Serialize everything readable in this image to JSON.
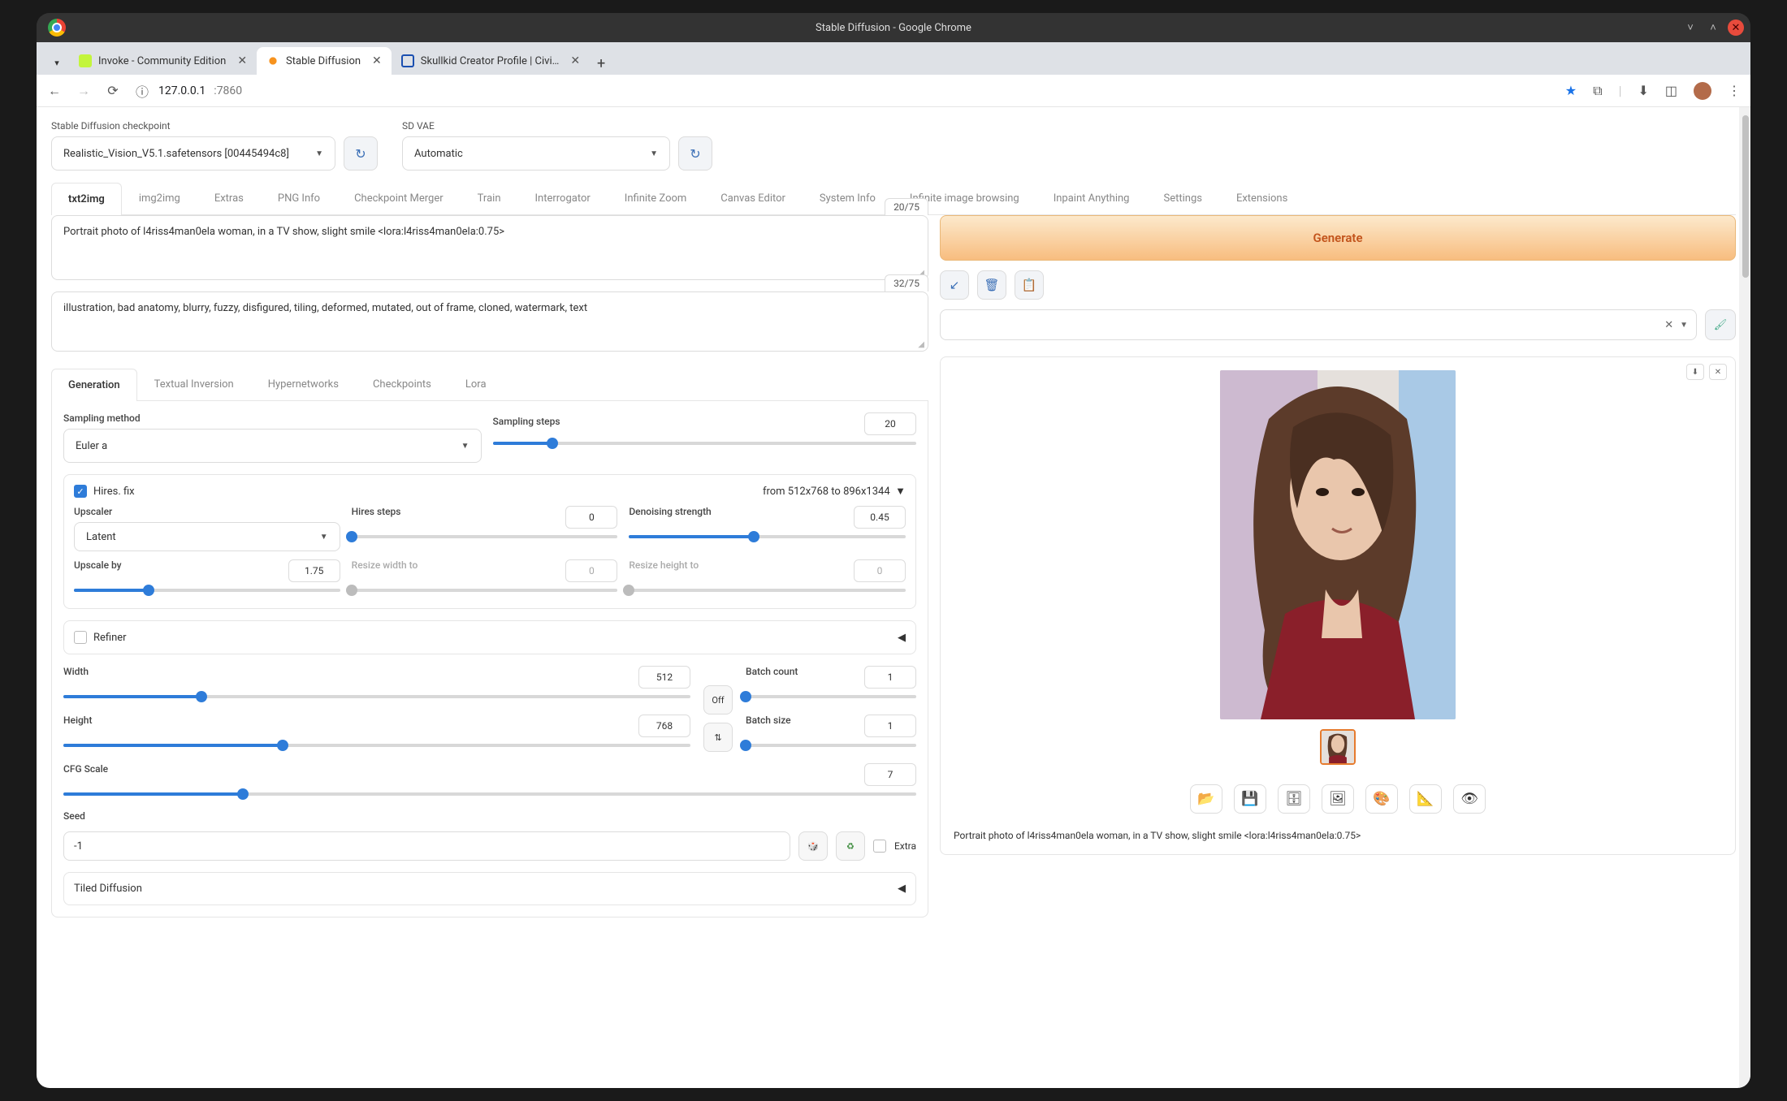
{
  "window": {
    "title": "Stable Diffusion - Google Chrome"
  },
  "browserTabs": [
    {
      "label": "Invoke - Community Edition",
      "active": false
    },
    {
      "label": "Stable Diffusion",
      "active": true
    },
    {
      "label": "Skullkid Creator Profile | Civi…",
      "active": false
    }
  ],
  "address": {
    "host": "127.0.0.1",
    "path": ":7860"
  },
  "checkpoint": {
    "label": "Stable Diffusion checkpoint",
    "value": "Realistic_Vision_V5.1.safetensors [00445494c8]"
  },
  "sdvae": {
    "label": "SD VAE",
    "value": "Automatic"
  },
  "mainTabs": [
    "txt2img",
    "img2img",
    "Extras",
    "PNG Info",
    "Checkpoint Merger",
    "Train",
    "Interrogator",
    "Infinite Zoom",
    "Canvas Editor",
    "System Info",
    "Infinite image browsing",
    "Inpaint Anything",
    "Settings",
    "Extensions"
  ],
  "prompt": {
    "text": "Portrait photo of l4riss4man0ela woman, in a TV show, slight smile  <lora:l4riss4man0ela:0.75>",
    "tokens": "20/75"
  },
  "negPrompt": {
    "text": "illustration, bad anatomy, blurry, fuzzy, disfigured, tiling, deformed, mutated, out of frame, cloned, watermark, text",
    "tokens": "32/75"
  },
  "generate": "Generate",
  "subTabs": [
    "Generation",
    "Textual Inversion",
    "Hypernetworks",
    "Checkpoints",
    "Lora"
  ],
  "sampling": {
    "methodLabel": "Sampling method",
    "method": "Euler a",
    "stepsLabel": "Sampling steps",
    "steps": "20"
  },
  "hires": {
    "title": "Hires. fix",
    "resText": "from 512x768  to 896x1344",
    "upscalerLabel": "Upscaler",
    "upscaler": "Latent",
    "hStepsLabel": "Hires steps",
    "hSteps": "0",
    "denoiseLabel": "Denoising strength",
    "denoise": "0.45",
    "upscaleByLabel": "Upscale by",
    "upscaleBy": "1.75",
    "resizeWLabel": "Resize width to",
    "resizeW": "0",
    "resizeHLabel": "Resize height to",
    "resizeH": "0"
  },
  "refiner": "Refiner",
  "dims": {
    "widthLabel": "Width",
    "width": "512",
    "heightLabel": "Height",
    "height": "768",
    "off": "Off",
    "swap": "⇅",
    "batchCountLabel": "Batch count",
    "batchCount": "1",
    "batchSizeLabel": "Batch size",
    "batchSize": "1"
  },
  "cfg": {
    "label": "CFG Scale",
    "value": "7"
  },
  "seed": {
    "label": "Seed",
    "value": "-1",
    "extra": "Extra"
  },
  "tiled": "Tiled Diffusion",
  "resultMeta": "Portrait photo of l4riss4man0ela woman, in a TV show, slight smile <lora:l4riss4man0ela:0.75>"
}
